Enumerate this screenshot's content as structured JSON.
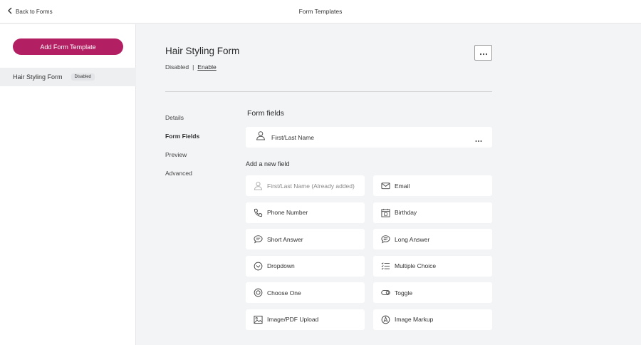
{
  "header": {
    "back_label": "Back to Forms",
    "title": "Form Templates"
  },
  "sidebar": {
    "add_button_label": "Add Form Template",
    "templates": [
      {
        "name": "Hair Styling Form",
        "badge": "Disabled"
      }
    ]
  },
  "form": {
    "title": "Hair Styling Form",
    "status": "Disabled",
    "separator": "|",
    "enable_label": "Enable"
  },
  "subnav": {
    "items": [
      "Details",
      "Form Fields",
      "Preview",
      "Advanced"
    ],
    "active": "Form Fields"
  },
  "fields_section": {
    "title": "Form fields",
    "added": [
      {
        "label": "First/Last Name",
        "icon": "person-icon"
      }
    ]
  },
  "add_section": {
    "title": "Add a new field",
    "options": [
      {
        "label": "First/Last Name (Already added)",
        "icon": "person-icon",
        "disabled": true
      },
      {
        "label": "Email",
        "icon": "envelope-icon"
      },
      {
        "label": "Phone Number",
        "icon": "phone-icon"
      },
      {
        "label": "Birthday",
        "icon": "calendar-icon"
      },
      {
        "label": "Short Answer",
        "icon": "speech-bubble-icon"
      },
      {
        "label": "Long Answer",
        "icon": "speech-bubble-icon"
      },
      {
        "label": "Dropdown",
        "icon": "chevron-circle-icon"
      },
      {
        "label": "Multiple Choice",
        "icon": "checklist-icon"
      },
      {
        "label": "Choose One",
        "icon": "radio-icon"
      },
      {
        "label": "Toggle",
        "icon": "toggle-icon"
      },
      {
        "label": "Image/PDF Upload",
        "icon": "image-icon"
      },
      {
        "label": "Image Markup",
        "icon": "markup-icon"
      }
    ]
  },
  "colors": {
    "accent": "#b21f63",
    "background": "#f3f4f6",
    "card": "#ffffff"
  }
}
